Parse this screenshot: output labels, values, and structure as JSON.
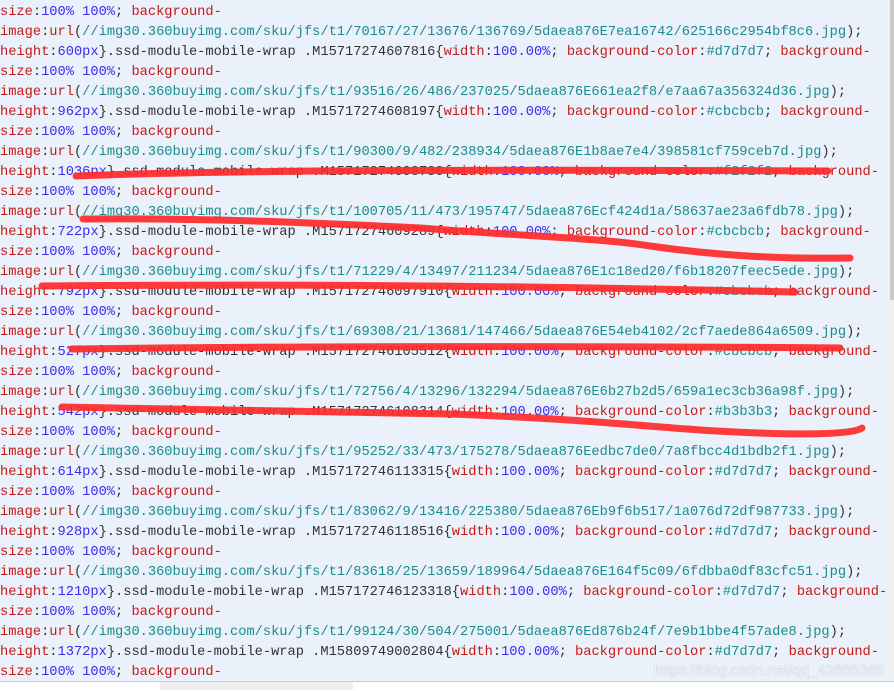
{
  "colors": {
    "property": "#c41a16",
    "value": "#3a2cf0",
    "url": "#1a8c8c",
    "plain": "#333333",
    "marker": "#ff2a2a",
    "background": "#eaf1fb"
  },
  "watermark": "https://blog.csdn.net/qq_43666365",
  "lines": [
    [
      [
        "prop",
        "size"
      ],
      [
        "plain",
        ":"
      ],
      [
        "val",
        "100% 100%"
      ],
      [
        "plain",
        "; "
      ],
      [
        "prop",
        "background-"
      ]
    ],
    [
      [
        "prop",
        "image"
      ],
      [
        "plain",
        ":"
      ],
      [
        "prop",
        "url"
      ],
      [
        "plain",
        "("
      ],
      [
        "url",
        "//img30.360buyimg.com/sku/jfs/t1/70167/27/13676/136769/5daea876E7ea16742/625166c2954bf8c6.jpg"
      ],
      [
        "plain",
        ");"
      ]
    ],
    [
      [
        "prop",
        "height"
      ],
      [
        "plain",
        ":"
      ],
      [
        "val",
        "600px"
      ],
      [
        "plain",
        "}.ssd-module-mobile-wrap .M15717274607816{"
      ],
      [
        "prop",
        "width"
      ],
      [
        "plain",
        ":"
      ],
      [
        "val",
        "100.00%"
      ],
      [
        "plain",
        "; "
      ],
      [
        "prop",
        "background-color"
      ],
      [
        "plain",
        ":"
      ],
      [
        "url",
        "#d7d7d7"
      ],
      [
        "plain",
        "; "
      ],
      [
        "prop",
        "background-"
      ]
    ],
    [
      [
        "prop",
        "size"
      ],
      [
        "plain",
        ":"
      ],
      [
        "val",
        "100% 100%"
      ],
      [
        "plain",
        "; "
      ],
      [
        "prop",
        "background-"
      ]
    ],
    [
      [
        "prop",
        "image"
      ],
      [
        "plain",
        ":"
      ],
      [
        "prop",
        "url"
      ],
      [
        "plain",
        "("
      ],
      [
        "url",
        "//img30.360buyimg.com/sku/jfs/t1/93516/26/486/237025/5daea876E661ea2f8/e7aa67a356324d36.jpg"
      ],
      [
        "plain",
        ");"
      ]
    ],
    [
      [
        "prop",
        "height"
      ],
      [
        "plain",
        ":"
      ],
      [
        "val",
        "962px"
      ],
      [
        "plain",
        "}.ssd-module-mobile-wrap .M15717274608197{"
      ],
      [
        "prop",
        "width"
      ],
      [
        "plain",
        ":"
      ],
      [
        "val",
        "100.00%"
      ],
      [
        "plain",
        "; "
      ],
      [
        "prop",
        "background-color"
      ],
      [
        "plain",
        ":"
      ],
      [
        "url",
        "#cbcbcb"
      ],
      [
        "plain",
        "; "
      ],
      [
        "prop",
        "background-"
      ]
    ],
    [
      [
        "prop",
        "size"
      ],
      [
        "plain",
        ":"
      ],
      [
        "val",
        "100% 100%"
      ],
      [
        "plain",
        "; "
      ],
      [
        "prop",
        "background-"
      ]
    ],
    [
      [
        "prop",
        "image"
      ],
      [
        "plain",
        ":"
      ],
      [
        "prop",
        "url"
      ],
      [
        "plain",
        "("
      ],
      [
        "url",
        "//img30.360buyimg.com/sku/jfs/t1/90300/9/482/238934/5daea876E1b8ae7e4/398581cf759ceb7d.jpg"
      ],
      [
        "plain",
        ");"
      ]
    ],
    [
      [
        "prop",
        "height"
      ],
      [
        "plain",
        ":"
      ],
      [
        "val",
        "1036px"
      ],
      [
        "plain",
        "}.ssd-module-mobile-wrap .M15717274608730{"
      ],
      [
        "prop",
        "width"
      ],
      [
        "plain",
        ":"
      ],
      [
        "val",
        "100.00%"
      ],
      [
        "plain",
        "; "
      ],
      [
        "prop",
        "background-color"
      ],
      [
        "plain",
        ":"
      ],
      [
        "url",
        "#f2f2f2"
      ],
      [
        "plain",
        "; "
      ],
      [
        "prop",
        "background-"
      ]
    ],
    [
      [
        "prop",
        "size"
      ],
      [
        "plain",
        ":"
      ],
      [
        "val",
        "100% 100%"
      ],
      [
        "plain",
        "; "
      ],
      [
        "prop",
        "background-"
      ]
    ],
    [
      [
        "prop",
        "image"
      ],
      [
        "plain",
        ":"
      ],
      [
        "prop",
        "url"
      ],
      [
        "plain",
        "("
      ],
      [
        "url",
        "//img30.360buyimg.com/sku/jfs/t1/100705/11/473/195747/5daea876Ecf424d1a/58637ae23a6fdb78.jpg"
      ],
      [
        "plain",
        ");"
      ]
    ],
    [
      [
        "prop",
        "height"
      ],
      [
        "plain",
        ":"
      ],
      [
        "val",
        "722px"
      ],
      [
        "plain",
        "}.ssd-module-mobile-wrap .M15717274609289{"
      ],
      [
        "prop",
        "width"
      ],
      [
        "plain",
        ":"
      ],
      [
        "val",
        "100.00%"
      ],
      [
        "plain",
        "; "
      ],
      [
        "prop",
        "background-color"
      ],
      [
        "plain",
        ":"
      ],
      [
        "url",
        "#cbcbcb"
      ],
      [
        "plain",
        "; "
      ],
      [
        "prop",
        "background-"
      ]
    ],
    [
      [
        "prop",
        "size"
      ],
      [
        "plain",
        ":"
      ],
      [
        "val",
        "100% 100%"
      ],
      [
        "plain",
        "; "
      ],
      [
        "prop",
        "background-"
      ]
    ],
    [
      [
        "prop",
        "image"
      ],
      [
        "plain",
        ":"
      ],
      [
        "prop",
        "url"
      ],
      [
        "plain",
        "("
      ],
      [
        "url",
        "//img30.360buyimg.com/sku/jfs/t1/71229/4/13497/211234/5daea876E1c18ed20/f6b18207feec5ede.jpg"
      ],
      [
        "plain",
        ");"
      ]
    ],
    [
      [
        "prop",
        "height"
      ],
      [
        "plain",
        ":"
      ],
      [
        "val",
        "792px"
      ],
      [
        "plain",
        "}.ssd-module-mobile-wrap .M157172746097910{"
      ],
      [
        "prop",
        "width"
      ],
      [
        "plain",
        ":"
      ],
      [
        "val",
        "100.00%"
      ],
      [
        "plain",
        "; "
      ],
      [
        "prop",
        "background-color"
      ],
      [
        "plain",
        ":"
      ],
      [
        "url",
        "#cbcbcb"
      ],
      [
        "plain",
        "; "
      ],
      [
        "prop",
        "background-"
      ]
    ],
    [
      [
        "prop",
        "size"
      ],
      [
        "plain",
        ":"
      ],
      [
        "val",
        "100% 100%"
      ],
      [
        "plain",
        "; "
      ],
      [
        "prop",
        "background-"
      ]
    ],
    [
      [
        "prop",
        "image"
      ],
      [
        "plain",
        ":"
      ],
      [
        "prop",
        "url"
      ],
      [
        "plain",
        "("
      ],
      [
        "url",
        "//img30.360buyimg.com/sku/jfs/t1/69308/21/13681/147466/5daea876E54eb4102/2cf7aede864a6509.jpg"
      ],
      [
        "plain",
        ");"
      ]
    ],
    [
      [
        "prop",
        "height"
      ],
      [
        "plain",
        ":"
      ],
      [
        "val",
        "527px"
      ],
      [
        "plain",
        "}.ssd-module-mobile-wrap .M157172746105512{"
      ],
      [
        "prop",
        "width"
      ],
      [
        "plain",
        ":"
      ],
      [
        "val",
        "100.00%"
      ],
      [
        "plain",
        "; "
      ],
      [
        "prop",
        "background-color"
      ],
      [
        "plain",
        ":"
      ],
      [
        "url",
        "#cbcbcb"
      ],
      [
        "plain",
        "; "
      ],
      [
        "prop",
        "background-"
      ]
    ],
    [
      [
        "prop",
        "size"
      ],
      [
        "plain",
        ":"
      ],
      [
        "val",
        "100% 100%"
      ],
      [
        "plain",
        "; "
      ],
      [
        "prop",
        "background-"
      ]
    ],
    [
      [
        "prop",
        "image"
      ],
      [
        "plain",
        ":"
      ],
      [
        "prop",
        "url"
      ],
      [
        "plain",
        "("
      ],
      [
        "url",
        "//img30.360buyimg.com/sku/jfs/t1/72756/4/13296/132294/5daea876E6b27b2d5/659a1ec3cb36a98f.jpg"
      ],
      [
        "plain",
        ");"
      ]
    ],
    [
      [
        "prop",
        "height"
      ],
      [
        "plain",
        ":"
      ],
      [
        "val",
        "542px"
      ],
      [
        "plain",
        "}.ssd-module-mobile-wrap .M157172746108314{"
      ],
      [
        "prop",
        "width"
      ],
      [
        "plain",
        ":"
      ],
      [
        "val",
        "100.00%"
      ],
      [
        "plain",
        "; "
      ],
      [
        "prop",
        "background-color"
      ],
      [
        "plain",
        ":"
      ],
      [
        "url",
        "#b3b3b3"
      ],
      [
        "plain",
        "; "
      ],
      [
        "prop",
        "background-"
      ]
    ],
    [
      [
        "prop",
        "size"
      ],
      [
        "plain",
        ":"
      ],
      [
        "val",
        "100% 100%"
      ],
      [
        "plain",
        "; "
      ],
      [
        "prop",
        "background-"
      ]
    ],
    [
      [
        "prop",
        "image"
      ],
      [
        "plain",
        ":"
      ],
      [
        "prop",
        "url"
      ],
      [
        "plain",
        "("
      ],
      [
        "url",
        "//img30.360buyimg.com/sku/jfs/t1/95252/33/473/175278/5daea876Eedbc7de0/7a8fbcc4d1bdb2f1.jpg"
      ],
      [
        "plain",
        ");"
      ]
    ],
    [
      [
        "prop",
        "height"
      ],
      [
        "plain",
        ":"
      ],
      [
        "val",
        "614px"
      ],
      [
        "plain",
        "}.ssd-module-mobile-wrap .M157172746113315{"
      ],
      [
        "prop",
        "width"
      ],
      [
        "plain",
        ":"
      ],
      [
        "val",
        "100.00%"
      ],
      [
        "plain",
        "; "
      ],
      [
        "prop",
        "background-color"
      ],
      [
        "plain",
        ":"
      ],
      [
        "url",
        "#d7d7d7"
      ],
      [
        "plain",
        "; "
      ],
      [
        "prop",
        "background-"
      ]
    ],
    [
      [
        "prop",
        "size"
      ],
      [
        "plain",
        ":"
      ],
      [
        "val",
        "100% 100%"
      ],
      [
        "plain",
        "; "
      ],
      [
        "prop",
        "background-"
      ]
    ],
    [
      [
        "prop",
        "image"
      ],
      [
        "plain",
        ":"
      ],
      [
        "prop",
        "url"
      ],
      [
        "plain",
        "("
      ],
      [
        "url",
        "//img30.360buyimg.com/sku/jfs/t1/83062/9/13416/225380/5daea876Eb9f6b517/1a076d72df987733.jpg"
      ],
      [
        "plain",
        ");"
      ]
    ],
    [
      [
        "prop",
        "height"
      ],
      [
        "plain",
        ":"
      ],
      [
        "val",
        "928px"
      ],
      [
        "plain",
        "}.ssd-module-mobile-wrap .M157172746118516{"
      ],
      [
        "prop",
        "width"
      ],
      [
        "plain",
        ":"
      ],
      [
        "val",
        "100.00%"
      ],
      [
        "plain",
        "; "
      ],
      [
        "prop",
        "background-color"
      ],
      [
        "plain",
        ":"
      ],
      [
        "url",
        "#d7d7d7"
      ],
      [
        "plain",
        "; "
      ],
      [
        "prop",
        "background-"
      ]
    ],
    [
      [
        "prop",
        "size"
      ],
      [
        "plain",
        ":"
      ],
      [
        "val",
        "100% 100%"
      ],
      [
        "plain",
        "; "
      ],
      [
        "prop",
        "background-"
      ]
    ],
    [
      [
        "prop",
        "image"
      ],
      [
        "plain",
        ":"
      ],
      [
        "prop",
        "url"
      ],
      [
        "plain",
        "("
      ],
      [
        "url",
        "//img30.360buyimg.com/sku/jfs/t1/83618/25/13659/189964/5daea876E164f5c09/6fdbba0df83cfc51.jpg"
      ],
      [
        "plain",
        ");"
      ]
    ],
    [
      [
        "prop",
        "height"
      ],
      [
        "plain",
        ":"
      ],
      [
        "val",
        "1210px"
      ],
      [
        "plain",
        "}.ssd-module-mobile-wrap .M157172746123318{"
      ],
      [
        "prop",
        "width"
      ],
      [
        "plain",
        ":"
      ],
      [
        "val",
        "100.00%"
      ],
      [
        "plain",
        "; "
      ],
      [
        "prop",
        "background-color"
      ],
      [
        "plain",
        ":"
      ],
      [
        "url",
        "#d7d7d7"
      ],
      [
        "plain",
        "; "
      ],
      [
        "prop",
        "background-"
      ]
    ],
    [
      [
        "prop",
        "size"
      ],
      [
        "plain",
        ":"
      ],
      [
        "val",
        "100% 100%"
      ],
      [
        "plain",
        "; "
      ],
      [
        "prop",
        "background-"
      ]
    ],
    [
      [
        "prop",
        "image"
      ],
      [
        "plain",
        ":"
      ],
      [
        "prop",
        "url"
      ],
      [
        "plain",
        "("
      ],
      [
        "url",
        "//img30.360buyimg.com/sku/jfs/t1/99124/30/504/275001/5daea876Ed876b24f/7e9b1bbe4f57ade8.jpg"
      ],
      [
        "plain",
        ");"
      ]
    ],
    [
      [
        "prop",
        "height"
      ],
      [
        "plain",
        ":"
      ],
      [
        "val",
        "1372px"
      ],
      [
        "plain",
        "}.ssd-module-mobile-wrap .M15809749002804{"
      ],
      [
        "prop",
        "width"
      ],
      [
        "plain",
        ":"
      ],
      [
        "val",
        "100.00%"
      ],
      [
        "plain",
        "; "
      ],
      [
        "prop",
        "background-color"
      ],
      [
        "plain",
        ":"
      ],
      [
        "url",
        "#d7d7d7"
      ],
      [
        "plain",
        "; "
      ],
      [
        "prop",
        "background-"
      ]
    ],
    [
      [
        "prop",
        "size"
      ],
      [
        "plain",
        ":"
      ],
      [
        "val",
        "100% 100%"
      ],
      [
        "plain",
        "; "
      ],
      [
        "prop",
        "background-"
      ]
    ]
  ]
}
